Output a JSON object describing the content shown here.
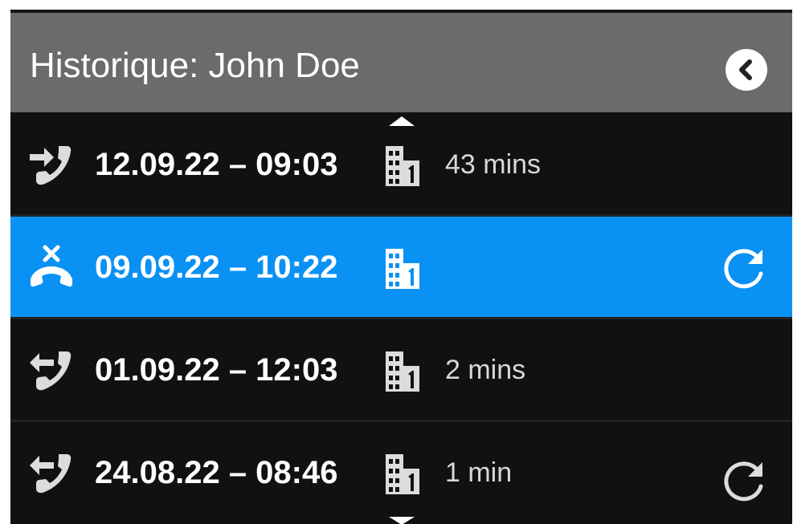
{
  "header": {
    "title": "Historique: John Doe"
  },
  "calls": [
    {
      "datetime": "12.09.22 – 09:03",
      "duration": "43 mins",
      "type": "forwarded-call-icon",
      "location": "building-icon",
      "redial": false,
      "selected": false
    },
    {
      "datetime": "09.09.22 – 10:22",
      "duration": "",
      "type": "missed-call-icon",
      "location": "building-icon",
      "redial": true,
      "selected": true
    },
    {
      "datetime": "01.09.22 – 12:03",
      "duration": "2 mins",
      "type": "outgoing-call-icon",
      "location": "building-icon",
      "redial": false,
      "selected": false
    },
    {
      "datetime": "24.08.22 – 08:46",
      "duration": "1 min",
      "type": "outgoing-call-icon",
      "location": "building-icon",
      "redial": true,
      "selected": false
    }
  ],
  "colors": {
    "header_bg": "#6b6b6b",
    "list_bg": "#111111",
    "selected_bg": "#0a91f4",
    "icon_light": "#dcdcdc"
  }
}
